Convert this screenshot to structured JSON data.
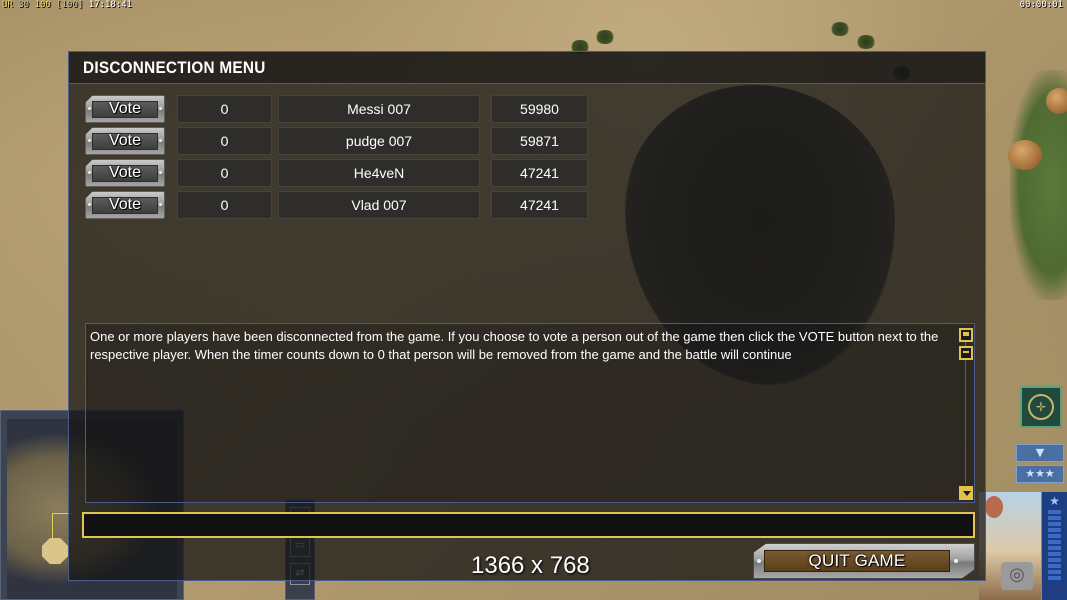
{
  "hud": {
    "ur_label": "UR",
    "fps": "30",
    "quality": "100",
    "quality_max": "[100]",
    "clock": "17:18:41",
    "game_timer": "00:00:01"
  },
  "dialog": {
    "title": "DISCONNECTION MENU",
    "vote_label": "Vote",
    "players": [
      {
        "votes": "0",
        "name": "Messi 007",
        "score": "59980"
      },
      {
        "votes": "0",
        "name": "pudge 007",
        "score": "59871"
      },
      {
        "votes": "0",
        "name": "He4veN",
        "score": "47241"
      },
      {
        "votes": "0",
        "name": "Vlad 007",
        "score": "47241"
      }
    ],
    "message": "One or more players have been disconnected from the game. If you choose to vote a person out of the game then click the VOTE button next to the respective player. When the timer counts down to 0 that person will be removed from the game and the battle will continue",
    "chat_value": "",
    "resolution": "1366 x 768",
    "quit_label": "QUIT GAME"
  },
  "colors": {
    "accent_gold": "#e0c552",
    "frame_blue": "#4d5a8a"
  },
  "icons": {
    "scroll_up": "scroll-up-icon",
    "scroll_down": "scroll-down-icon",
    "compass": "compass-icon",
    "rank": "rank-stars-icon"
  }
}
